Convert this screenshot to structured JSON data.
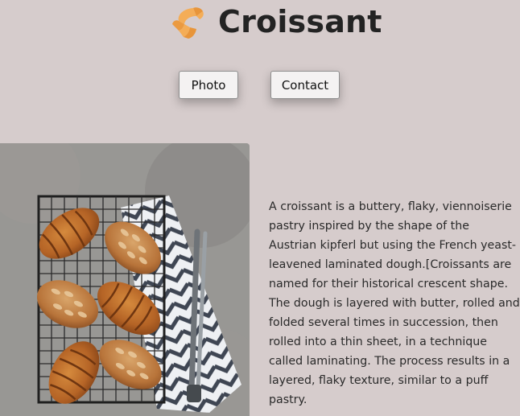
{
  "header": {
    "title": "Croissant",
    "logo_icon": "croissant-icon"
  },
  "nav": {
    "photo_label": "Photo",
    "contact_label": "Contact"
  },
  "main": {
    "image_alt": "croissants-photo",
    "description": "A croissant is a buttery, flaky, viennoiserie pastry inspired by the shape of the Austrian kipferl but using the French yeast-leavened laminated dough.[Croissants are named for their historical crescent shape. The dough is layered with butter, rolled and folded several times in succession, then rolled into a thin sheet, in a technique called laminating. The process results in a layered, flaky texture, similar to a puff pastry."
  },
  "colors": {
    "background": "#d6cccc",
    "title_text": "#232323",
    "logo_orange": "#f0a24a",
    "button_bg": "#f4f2f2"
  }
}
